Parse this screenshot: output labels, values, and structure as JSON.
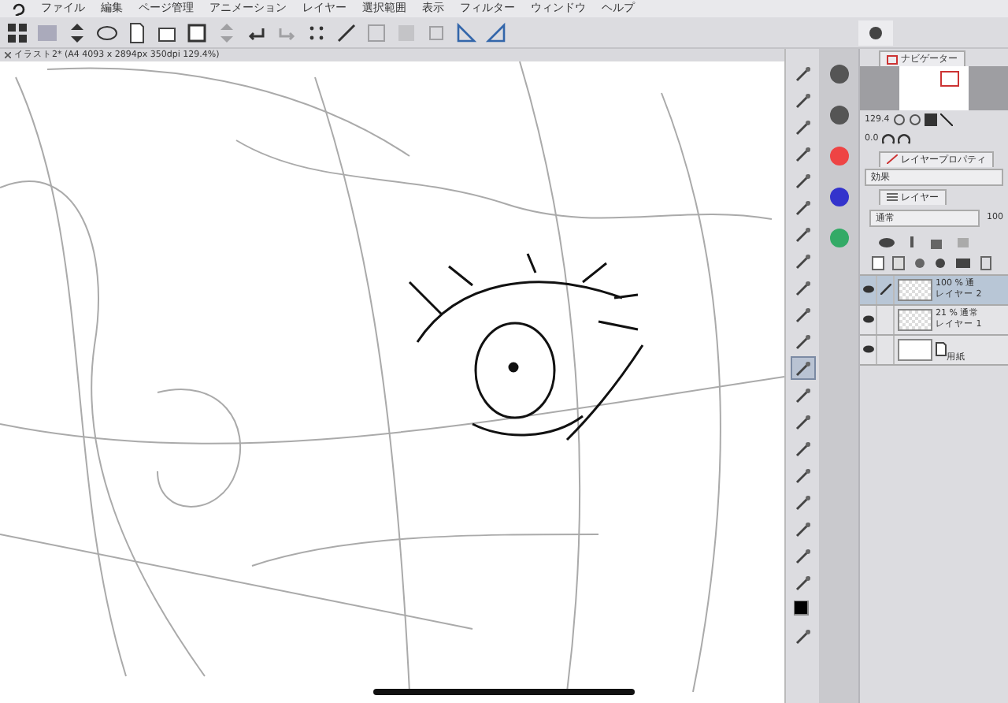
{
  "menu": [
    "ファイル",
    "編集",
    "ページ管理",
    "アニメーション",
    "レイヤー",
    "選択範囲",
    "表示",
    "フィルター",
    "ウィンドウ",
    "ヘルプ"
  ],
  "toolbar": [
    {
      "disabled": false
    },
    {
      "disabled": false
    },
    {
      "disabled": false
    },
    {
      "disabled": false
    },
    {
      "disabled": false
    },
    {
      "disabled": false
    },
    {
      "disabled": false
    },
    {
      "disabled": true
    },
    {
      "disabled": false
    },
    {
      "disabled": true
    },
    {
      "disabled": false
    },
    {
      "disabled": false
    },
    {
      "disabled": true
    },
    {
      "disabled": true
    },
    {
      "disabled": true
    },
    {
      "disabled": false
    },
    {
      "disabled": false
    }
  ],
  "document_tab": {
    "title": "イラスト2* (A4 4093 x 2894px 350dpi 129.4%)"
  },
  "tools": [
    {
      "selected": false
    },
    {
      "selected": false
    },
    {
      "selected": false
    },
    {
      "selected": false
    },
    {
      "selected": false
    },
    {
      "selected": false
    },
    {
      "selected": false
    },
    {
      "selected": false
    },
    {
      "selected": false
    },
    {
      "selected": false
    },
    {
      "selected": false
    },
    {
      "selected": true
    },
    {
      "selected": false
    },
    {
      "selected": false
    },
    {
      "selected": false
    },
    {
      "selected": false
    },
    {
      "selected": false
    },
    {
      "selected": false
    },
    {
      "selected": false
    },
    {
      "selected": false
    },
    {
      "selected": false
    },
    {
      "selected": false
    }
  ],
  "navigator": {
    "title": "ナビゲーター",
    "zoom": "129.4",
    "rotation": "0.0"
  },
  "layer_property": {
    "title": "レイヤープロパティ",
    "effect_label": "効果"
  },
  "layers_panel": {
    "title": "レイヤー",
    "blend_mode": "通常",
    "opacity": "100",
    "layers": [
      {
        "kind": "raster",
        "mode": "100 % 通",
        "name": "レイヤー 2",
        "visible": true,
        "selected": true
      },
      {
        "kind": "raster",
        "mode": "21 % 通常",
        "name": "レイヤー 1",
        "visible": true,
        "selected": false
      },
      {
        "kind": "paper",
        "name": "用紙",
        "visible": true,
        "selected": false
      }
    ]
  }
}
